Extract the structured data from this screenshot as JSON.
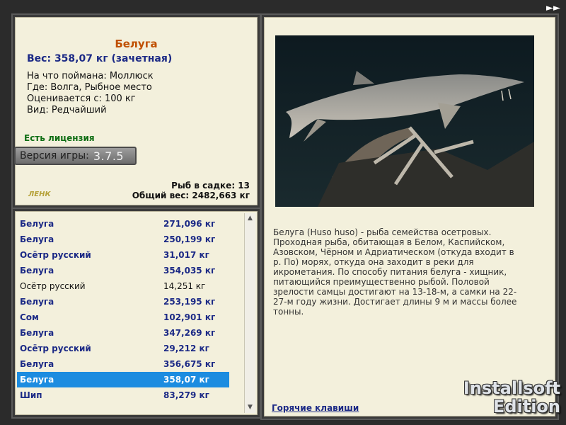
{
  "nav": {
    "forward_icon": "fast-forward-icon"
  },
  "fish": {
    "title": "Белуга",
    "weight_label": "Вес: 358,07 кг (зачетная)",
    "fields": [
      "На что поймана: Моллюск",
      "Где: Волга, Рыбное место",
      "Оценивается с: 100 кг",
      "Вид: Редчайший"
    ],
    "license": "Есть лицензия",
    "description": "Белуга (Huso huso) - рыба семейства осетровых. Проходная рыба, обитающая в Белом, Каспийском, Азовском, Чёрном и Адриатическом (откуда входит в р. По) морях, откуда она заходит в реки для икрометания. По способу питания белуга - хищник, питающийся преимущественно рыбой. Половой зрелости самцы достигают на 13-18-м, а самки на 22-27-м году жизни. Достигает длины 9 м и массы более тонны."
  },
  "version": {
    "label": "Версия игры:",
    "number": "3.7.5"
  },
  "small_logo": "ЛЕНК",
  "stats": {
    "fish_in_cage": "Рыб в садке: 13",
    "total_weight": "Общий вес: 2482,663 кг"
  },
  "catch_list": [
    {
      "name": "Белуга",
      "weight": "271,096 кг",
      "style": "bold"
    },
    {
      "name": "Белуга",
      "weight": "250,199 кг",
      "style": "bold"
    },
    {
      "name": "Осётр русский",
      "weight": "31,017 кг",
      "style": "bold"
    },
    {
      "name": "Белуга",
      "weight": "354,035 кг",
      "style": "bold"
    },
    {
      "name": "Осётр русский",
      "weight": "14,251 кг",
      "style": "plain"
    },
    {
      "name": "Белуга",
      "weight": "253,195 кг",
      "style": "bold"
    },
    {
      "name": "Сом",
      "weight": "102,901 кг",
      "style": "bold"
    },
    {
      "name": "Белуга",
      "weight": "347,269 кг",
      "style": "bold"
    },
    {
      "name": "Осётр русский",
      "weight": "29,212 кг",
      "style": "bold"
    },
    {
      "name": "Белуга",
      "weight": "356,675 кг",
      "style": "bold"
    },
    {
      "name": "Белуга",
      "weight": "358,07 кг",
      "style": "selected"
    },
    {
      "name": "Шип",
      "weight": "83,279 кг",
      "style": "bold"
    }
  ],
  "hotkeys_link": "Горячие клавиши",
  "brand": {
    "line1": "Installsoft",
    "line2": "Edition"
  },
  "colors": {
    "accent_title": "#c05000",
    "link_blue": "#1c2a86",
    "license_green": "#0f6e14",
    "selection": "#1c8ce0"
  }
}
